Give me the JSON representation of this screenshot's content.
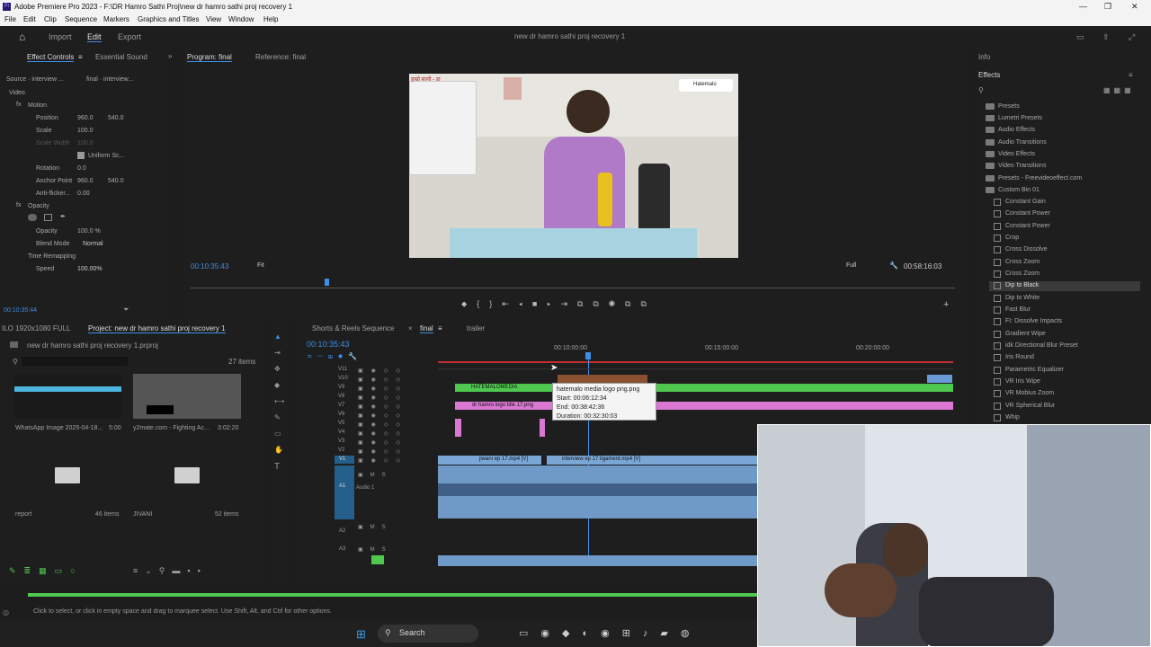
{
  "app": {
    "title": "Adobe Premiere Pro 2023 - F:\\DR Hamro Sathi Proj\\new dr hamro sathi proj recovery 1",
    "icon": "Pr"
  },
  "menu": [
    "File",
    "Edit",
    "Clip",
    "Sequence",
    "Markers",
    "Graphics and Titles",
    "View",
    "Window",
    "Help"
  ],
  "toolbar": {
    "import": "Import",
    "edit": "Edit",
    "export": "Export",
    "project_title": "new dr hamro sathi proj recovery 1"
  },
  "effect_controls": {
    "tab": "Effect Controls",
    "tab2": "Essential Sound",
    "source": "Source · interview ...",
    "clip": "final · interview...",
    "video": "Video",
    "motion": "Motion",
    "position": "Position",
    "pos_x": "960.0",
    "pos_y": "540.0",
    "scale": "Scale",
    "scale_val": "100.0",
    "scale_width": "Scale Width",
    "scale_width_val": "100.0",
    "uniform": "Uniform Sc...",
    "rotation": "Rotation",
    "rotation_val": "0.0",
    "anchor": "Anchor Point",
    "anchor_x": "960.0",
    "anchor_y": "540.0",
    "antiflicker": "Anti-flicker...",
    "antiflicker_val": "0.00",
    "opacity_group": "Opacity",
    "opacity": "Opacity",
    "opacity_val": "100.0 %",
    "blend": "Blend Mode",
    "blend_val": "Normal",
    "time_remap": "Time Remapping",
    "speed": "Speed",
    "speed_val": "100.00%",
    "timecode": "00:10:35:44"
  },
  "program": {
    "tab": "Program: final",
    "ref": "Reference: final",
    "timecode": "00:10:35:43",
    "fit": "Fit",
    "quality": "Full",
    "duration": "00:58:16:03",
    "video_banner": "Hatemalo",
    "video_top_text": "हाम्रो साथी - डा"
  },
  "effects": {
    "info": "Info",
    "tab": "Effects",
    "items": [
      "Presets",
      "Lumetri Presets",
      "Audio Effects",
      "Audio Transitions",
      "Video Effects",
      "Video Transitions",
      "Presets - Freevideoeffect.com",
      "Custom Bin 01"
    ],
    "custom": [
      "Constant Gain",
      "Constant Power",
      "Constant Power",
      "Crop",
      "Cross Dissolve",
      "Cross Zoom",
      "Cross Zoom",
      "Dip to Black",
      "Dip to White",
      "Fast Blur",
      "FI: Dissolve Impacts",
      "Gradient Wipe",
      "idk Directional Blur Preset",
      "Iris Round",
      "Parametric Equalizer",
      "VR Iris Wipe",
      "VR Mobius Zoom",
      "VR Spherical Blur",
      "Whip"
    ]
  },
  "project": {
    "left_label": "ILO 1920x1080 FULL",
    "tab": "Project: new dr hamro sathi proj recovery 1",
    "file": "new dr hamro sathi proj recovery 1.prproj",
    "count": "27 items",
    "items": [
      {
        "name": "WhatsApp Image 2025-04-18...",
        "dur": "5:00"
      },
      {
        "name": "y2mate.com - Fighting Ac...",
        "dur": "3:02:20"
      },
      {
        "name": "report",
        "dur": "46 items"
      },
      {
        "name": "JIVANI",
        "dur": "52 items"
      }
    ]
  },
  "timeline": {
    "tabs": [
      "Shorts & Reels Sequence",
      "final",
      "trailer"
    ],
    "timecode": "00:10:35:43",
    "ruler": [
      "00:10:00:00",
      "00:15:00:00",
      "00:20:00:00"
    ],
    "tracks": [
      "V11",
      "V10",
      "V9",
      "V8",
      "V7",
      "V6",
      "V5",
      "V4",
      "V3",
      "V2",
      "V1",
      "A1",
      "A2",
      "A3"
    ],
    "audio1": "Audio 1",
    "clip_hatemalo": "HATEMALOMEDIA",
    "clip_logo": "dr hamro logo title 17.png",
    "clip_v1a": "jiwani ep 17.mp4 [V]",
    "clip_v1b": "interview ep 17 ligament.mp4 [V]",
    "tooltip": {
      "name": "hatemalo media logo png.png",
      "start": "Start: 00:06:12:34",
      "end": "End: 00:38:42:36",
      "duration": "Duration: 00:32:30:03"
    }
  },
  "status": "Click to select, or click in empty space and drag to marquee select. Use Shift, Alt, and Ctrl for other options.",
  "taskbar": {
    "search": "Search"
  },
  "colors": {
    "accent": "#3e8ee6",
    "green_clip": "#4fc84f",
    "pink_clip": "#d977d2",
    "audio_clip": "#7aa6d6"
  }
}
